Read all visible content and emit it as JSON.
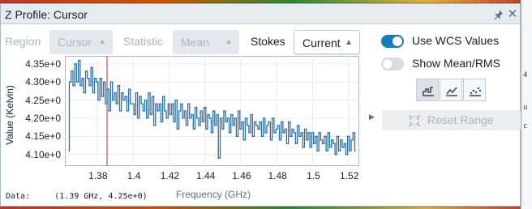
{
  "window": {
    "title": "Z Profile: Cursor"
  },
  "controls": {
    "region_label": "Region",
    "region_value": "Cursor",
    "statistic_label": "Statistic",
    "statistic_value": "Mean",
    "stokes_label": "Stokes",
    "stokes_value": "Current"
  },
  "options": {
    "use_wcs_label": "Use WCS Values",
    "use_wcs_on": true,
    "show_mean_rms_label": "Show Mean/RMS",
    "show_mean_rms_on": false,
    "plot_types": [
      "steps",
      "lines",
      "points"
    ],
    "active_plot_type": "steps",
    "reset_range_label": "Reset Range"
  },
  "readout": {
    "label": "Data:",
    "value": "(1.39 GHz, 4.25e+0)"
  },
  "colors": {
    "line": "#2b6ea8",
    "cursor_marker": "#c23030",
    "accent": "#137cbd"
  },
  "chart_data": {
    "type": "line",
    "title": "",
    "xlabel": "Frequency (GHz)",
    "ylabel": "Value (Kelvin)",
    "xlim": [
      1.362,
      1.526
    ],
    "ylim": [
      4.068,
      4.372
    ],
    "xticks": [
      1.38,
      1.4,
      1.42,
      1.44,
      1.46,
      1.48,
      1.5,
      1.52
    ],
    "xtick_labels": [
      "1.38",
      "1.4",
      "1.42",
      "1.44",
      "1.46",
      "1.48",
      "1.5",
      "1.52"
    ],
    "yticks": [
      4.1,
      4.15,
      4.2,
      4.25,
      4.3,
      4.35
    ],
    "ytick_labels": [
      "4.10e+0",
      "4.15e+0",
      "4.20e+0",
      "4.25e+0",
      "4.30e+0",
      "4.35e+0"
    ],
    "cursor_x": 1.3855,
    "grid": true,
    "series": [
      {
        "x": [
          1.364,
          1.365,
          1.366,
          1.367,
          1.368,
          1.369,
          1.37,
          1.371,
          1.372,
          1.373,
          1.374,
          1.375,
          1.376,
          1.377,
          1.378,
          1.379,
          1.38,
          1.381,
          1.382,
          1.383,
          1.384,
          1.385,
          1.386,
          1.387,
          1.388,
          1.389,
          1.39,
          1.391,
          1.392,
          1.393,
          1.394,
          1.395,
          1.396,
          1.397,
          1.398,
          1.399,
          1.4,
          1.401,
          1.402,
          1.403,
          1.404,
          1.405,
          1.406,
          1.407,
          1.408,
          1.409,
          1.41,
          1.411,
          1.412,
          1.413,
          1.414,
          1.415,
          1.416,
          1.417,
          1.418,
          1.419,
          1.42,
          1.421,
          1.422,
          1.423,
          1.424,
          1.425,
          1.426,
          1.427,
          1.428,
          1.429,
          1.43,
          1.431,
          1.432,
          1.433,
          1.434,
          1.435,
          1.436,
          1.437,
          1.438,
          1.439,
          1.44,
          1.441,
          1.442,
          1.443,
          1.444,
          1.445,
          1.446,
          1.447,
          1.448,
          1.449,
          1.45,
          1.451,
          1.452,
          1.453,
          1.454,
          1.455,
          1.456,
          1.457,
          1.458,
          1.459,
          1.46,
          1.461,
          1.462,
          1.463,
          1.464,
          1.465,
          1.466,
          1.467,
          1.468,
          1.469,
          1.47,
          1.471,
          1.472,
          1.473,
          1.474,
          1.475,
          1.476,
          1.477,
          1.478,
          1.479,
          1.48,
          1.481,
          1.482,
          1.483,
          1.484,
          1.485,
          1.486,
          1.487,
          1.488,
          1.489,
          1.49,
          1.491,
          1.492,
          1.493,
          1.494,
          1.495,
          1.496,
          1.497,
          1.498,
          1.499,
          1.5,
          1.501,
          1.502,
          1.503,
          1.504,
          1.505,
          1.506,
          1.507,
          1.508,
          1.509,
          1.51,
          1.511,
          1.512,
          1.513,
          1.514,
          1.515,
          1.516,
          1.517,
          1.518,
          1.519,
          1.52,
          1.521,
          1.522,
          1.523,
          1.524
        ],
        "y": [
          4.11,
          4.3,
          4.33,
          4.29,
          4.35,
          4.3,
          4.36,
          4.29,
          4.31,
          4.27,
          4.33,
          4.31,
          4.29,
          4.34,
          4.27,
          4.31,
          4.3,
          4.25,
          4.31,
          4.26,
          4.3,
          4.24,
          4.28,
          4.22,
          4.3,
          4.25,
          4.27,
          4.24,
          4.29,
          4.22,
          4.27,
          4.25,
          4.26,
          4.22,
          4.28,
          4.24,
          4.24,
          4.21,
          4.27,
          4.2,
          4.26,
          4.24,
          4.22,
          4.25,
          4.2,
          4.27,
          4.21,
          4.26,
          4.18,
          4.24,
          4.22,
          4.24,
          4.19,
          4.26,
          4.22,
          4.2,
          4.24,
          4.21,
          4.24,
          4.19,
          4.25,
          4.17,
          4.22,
          4.24,
          4.2,
          4.22,
          4.18,
          4.24,
          4.2,
          4.21,
          4.17,
          4.23,
          4.2,
          4.18,
          4.22,
          4.19,
          4.23,
          4.17,
          4.21,
          4.2,
          4.16,
          4.22,
          4.18,
          4.21,
          4.09,
          4.2,
          4.17,
          4.22,
          4.19,
          4.2,
          4.16,
          4.21,
          4.18,
          4.2,
          4.15,
          4.22,
          4.17,
          4.19,
          4.14,
          4.2,
          4.18,
          4.16,
          4.21,
          4.15,
          4.19,
          4.18,
          4.17,
          4.19,
          4.15,
          4.2,
          4.16,
          4.18,
          4.19,
          4.14,
          4.2,
          4.16,
          4.17,
          4.18,
          4.14,
          4.19,
          4.16,
          4.17,
          4.13,
          4.19,
          4.15,
          4.17,
          4.16,
          4.13,
          4.18,
          4.15,
          4.16,
          4.12,
          4.17,
          4.14,
          4.16,
          4.12,
          4.16,
          4.13,
          4.15,
          4.11,
          4.16,
          4.14,
          4.13,
          4.15,
          4.11,
          4.16,
          4.12,
          4.14,
          4.13,
          4.1,
          4.15,
          4.11,
          4.14,
          4.12,
          4.13,
          4.1,
          4.15,
          4.11,
          4.14,
          4.16,
          4.11
        ]
      }
    ]
  }
}
